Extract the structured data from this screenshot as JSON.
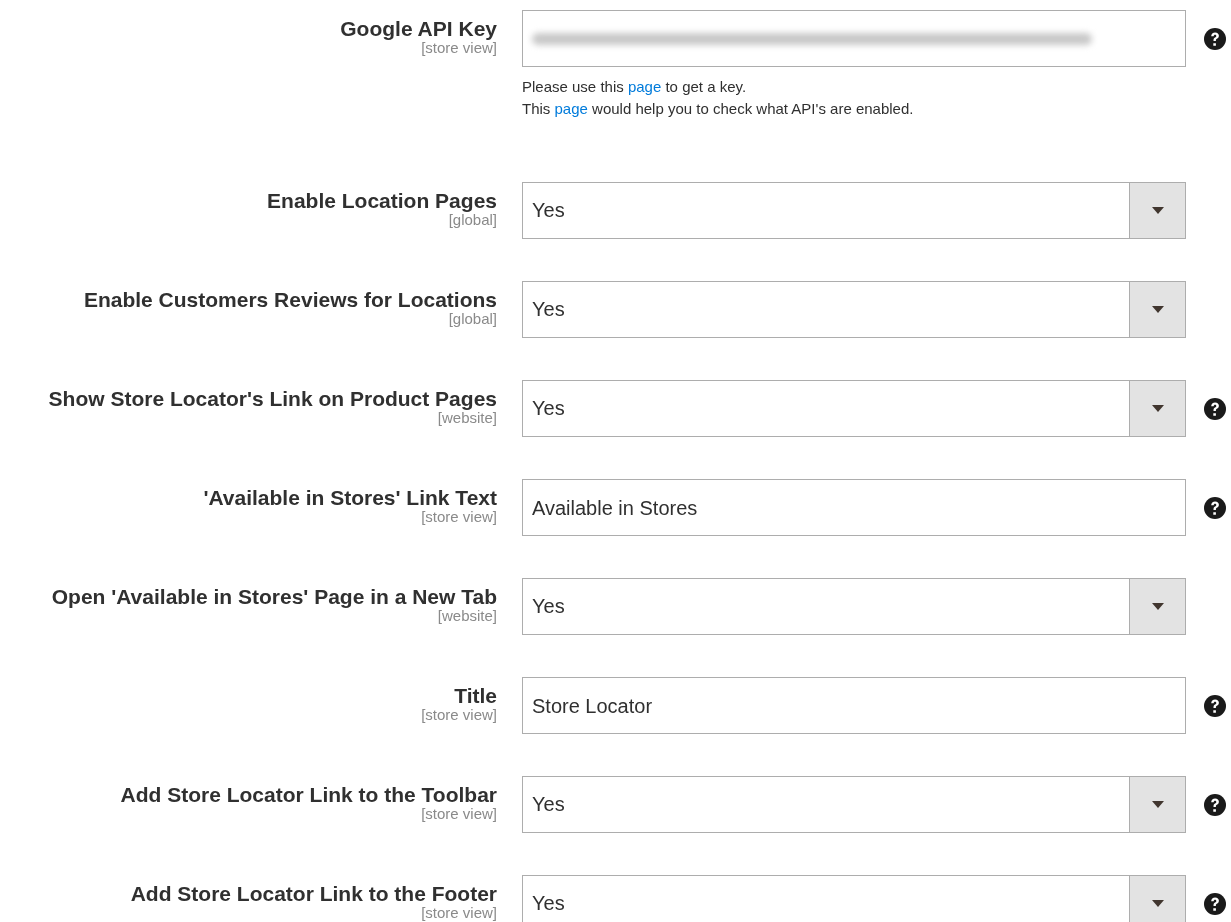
{
  "fields": [
    {
      "kind": "text",
      "label": "Google API Key",
      "scope": "[store view]",
      "redacted": true,
      "help": true,
      "notes": [
        [
          {
            "text": "Please use this "
          },
          {
            "text": "page",
            "link": true
          },
          {
            "text": " to get a key."
          }
        ],
        [
          {
            "text": "This "
          },
          {
            "text": "page",
            "link": true
          },
          {
            "text": " would help you to check what API's are enabled."
          }
        ]
      ]
    },
    {
      "kind": "select",
      "label": "Enable Location Pages",
      "scope": "[global]",
      "value": "Yes",
      "help": false
    },
    {
      "kind": "select",
      "label": "Enable Customers Reviews for Locations",
      "scope": "[global]",
      "value": "Yes",
      "help": false
    },
    {
      "kind": "select",
      "label": "Show Store Locator's Link on Product Pages",
      "scope": "[website]",
      "value": "Yes",
      "help": true
    },
    {
      "kind": "text",
      "label": "'Available in Stores' Link Text",
      "scope": "[store view]",
      "value": "Available in Stores",
      "help": true
    },
    {
      "kind": "select",
      "label": "Open 'Available in Stores' Page in a New Tab",
      "scope": "[website]",
      "value": "Yes",
      "help": false
    },
    {
      "kind": "text",
      "label": "Title",
      "scope": "[store view]",
      "value": "Store Locator",
      "help": true
    },
    {
      "kind": "select",
      "label": "Add Store Locator Link to the Toolbar",
      "scope": "[store view]",
      "value": "Yes",
      "help": true
    },
    {
      "kind": "select",
      "label": "Add Store Locator Link to the Footer",
      "scope": "[store view]",
      "value": "Yes",
      "help": true
    }
  ]
}
